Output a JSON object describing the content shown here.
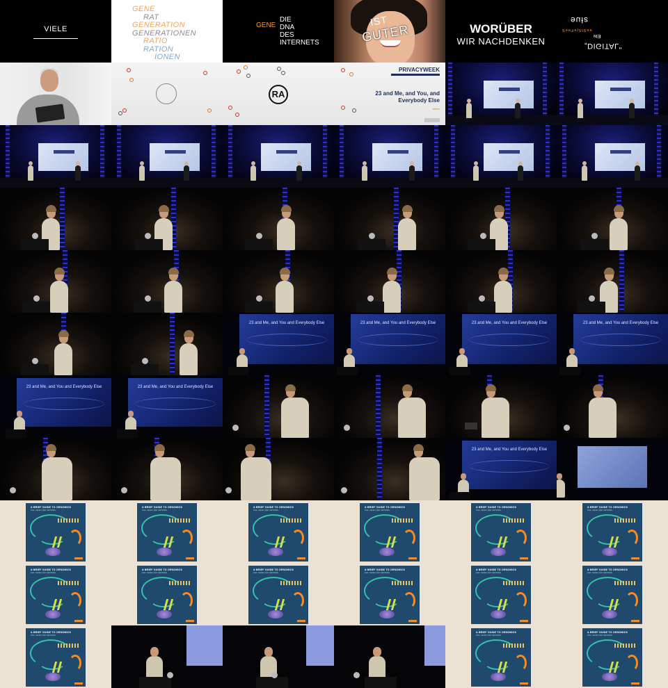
{
  "title_cards": {
    "viele": "VIELE",
    "generation_words": [
      {
        "text": "GENE",
        "tone": "orange",
        "indent": 0
      },
      {
        "text": "RAT",
        "tone": "grey",
        "indent": 1
      },
      {
        "text": "GENERATION",
        "tone": "orange",
        "indent": 0
      },
      {
        "text": "GENERATIONEN",
        "tone": "grey",
        "indent": 0
      },
      {
        "text": "RATIO",
        "tone": "orange",
        "indent": 1
      },
      {
        "text": "RATION",
        "tone": "blue",
        "indent": 1
      },
      {
        "text": "IONEN",
        "tone": "blue",
        "indent": 2
      }
    ],
    "dna_gene": "GENE",
    "dna_lines": [
      "DIE",
      "DNA",
      "DES",
      "INTERNETS"
    ],
    "ist": "IST",
    "guter": "GUTER",
    "woruber_line1": "WORÜBER",
    "woruber_line2": "WIR NACHDENKEN",
    "flip_top": "ɘuƚƨ",
    "flip_sub": "ƧɘᴎꟻɘɿƧƚƧɘᴎ",
    "flip_mid": "ᴎIƎ",
    "digital": "„DIGITAL\""
  },
  "conference_slide": {
    "logo": "PRIVACYWEEK",
    "title": "23 and Me, and You, and Everybody Else",
    "subtitle": "Mirror",
    "ra_mark": "RA"
  },
  "talk_slide_title": "23 and Me, and You and Everybody Else",
  "guide_slide": {
    "title": "A BRIEF GUIDE TO GENOMICS",
    "subtitle": "DNA, GENES AND GENOMES"
  },
  "colors": {
    "accent_orange": "#f39a2a",
    "stage_blue": "#2f31c9",
    "guide_background": "#ece2d4"
  }
}
